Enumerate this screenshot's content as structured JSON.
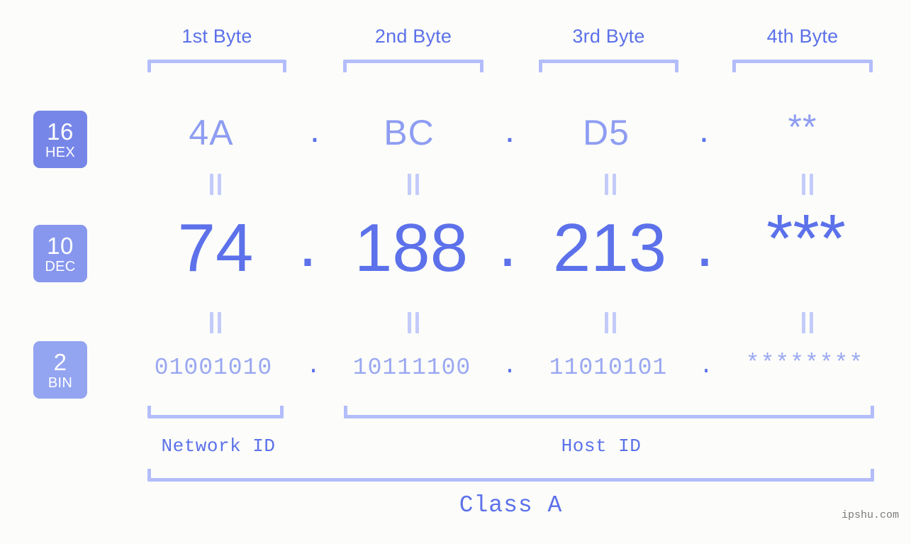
{
  "background": "#fcfdfa",
  "accent": "#5c71ea",
  "accent_light": "#8e9df2",
  "bracket_color": "#b3bdfa",
  "byte_headers": [
    {
      "label": "1st Byte"
    },
    {
      "label": "2nd Byte"
    },
    {
      "label": "3rd Byte"
    },
    {
      "label": "4th Byte"
    }
  ],
  "rows": {
    "hex": {
      "badge_num": "16",
      "badge_label": "HEX",
      "badge_color": "#7686e8",
      "values": [
        "4A",
        "BC",
        "D5",
        "**"
      ],
      "separator": "."
    },
    "dec": {
      "badge_num": "10",
      "badge_label": "DEC",
      "badge_color": "#8797ee",
      "values": [
        "74",
        "188",
        "213",
        "***"
      ],
      "separator": "."
    },
    "bin": {
      "badge_num": "2",
      "badge_label": "BIN",
      "badge_color": "#93a4f0",
      "values": [
        "01001010",
        "10111100",
        "11010101",
        "********"
      ],
      "separator": "."
    }
  },
  "equals_marks": {
    "symbol": "=",
    "count_per_row": 4
  },
  "segments": {
    "network_id": "Network ID",
    "host_id": "Host ID",
    "class": "Class A"
  },
  "watermark": "ipshu.com"
}
